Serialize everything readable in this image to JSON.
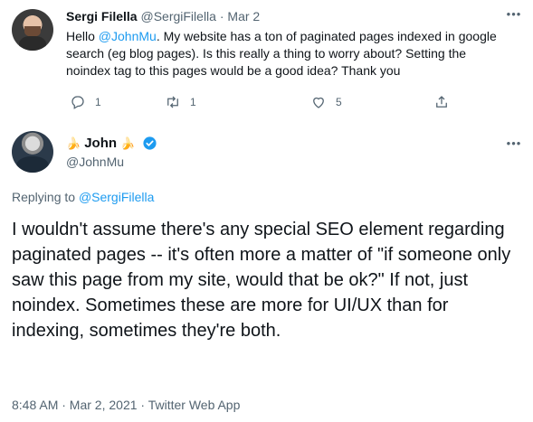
{
  "tweet_parent": {
    "author_name": "Sergi Filella",
    "author_handle": "@SergiFilella",
    "separator": " · ",
    "date": "Mar 2",
    "body_prefix": "Hello ",
    "body_mention": "@JohnMu",
    "body_text": ". My website has a ton of paginated pages indexed in google search (eg blog pages). Is this really a thing to worry about? Setting the noindex tag to this pages would be a good idea? Thank you",
    "replies_count": "1",
    "retweets_count": "1",
    "likes_count": "5",
    "more_label": "•••"
  },
  "tweet_main": {
    "author_name": "John",
    "author_handle": "@JohnMu",
    "name_emoji": "🍌",
    "replying_prefix": "Replying to ",
    "replying_handle": "@SergiFilella",
    "body": "I wouldn't assume there's any special SEO element regarding paginated pages -- it's often more a matter of \"if someone only saw this page from my site, would that be ok?\" If not, just noindex. Sometimes these are more for UI/UX than for indexing, sometimes they're both.",
    "timestamp": "8:48 AM · Mar 2, 2021 · Twitter Web App",
    "more_label": "•••"
  },
  "colors": {
    "link": "#1d9bf0",
    "secondary_text": "#536471",
    "verified": "#1d9bf0"
  },
  "icons": [
    "reply-icon",
    "retweet-icon",
    "like-icon",
    "share-icon",
    "verified-icon",
    "more-icon"
  ]
}
